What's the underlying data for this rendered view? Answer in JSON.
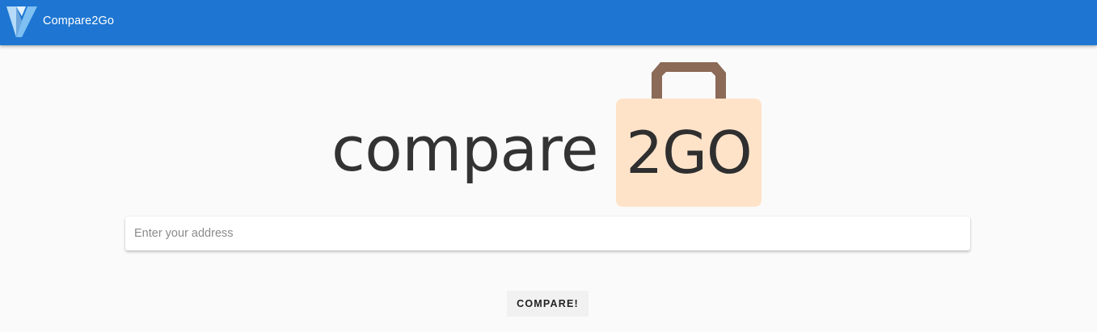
{
  "app_bar": {
    "title": "Compare2Go",
    "logo_icon": "vuetify-v-logo-icon",
    "background_color": "#1e76d2"
  },
  "hero": {
    "word": "compare",
    "bag_text": "2GO",
    "bag_color": "#ffe3c9",
    "handle_color": "#8b6a58",
    "icon": "shopping-bag-icon"
  },
  "search": {
    "placeholder": "Enter your address",
    "value": ""
  },
  "actions": {
    "compare_label": "COMPARE!"
  }
}
